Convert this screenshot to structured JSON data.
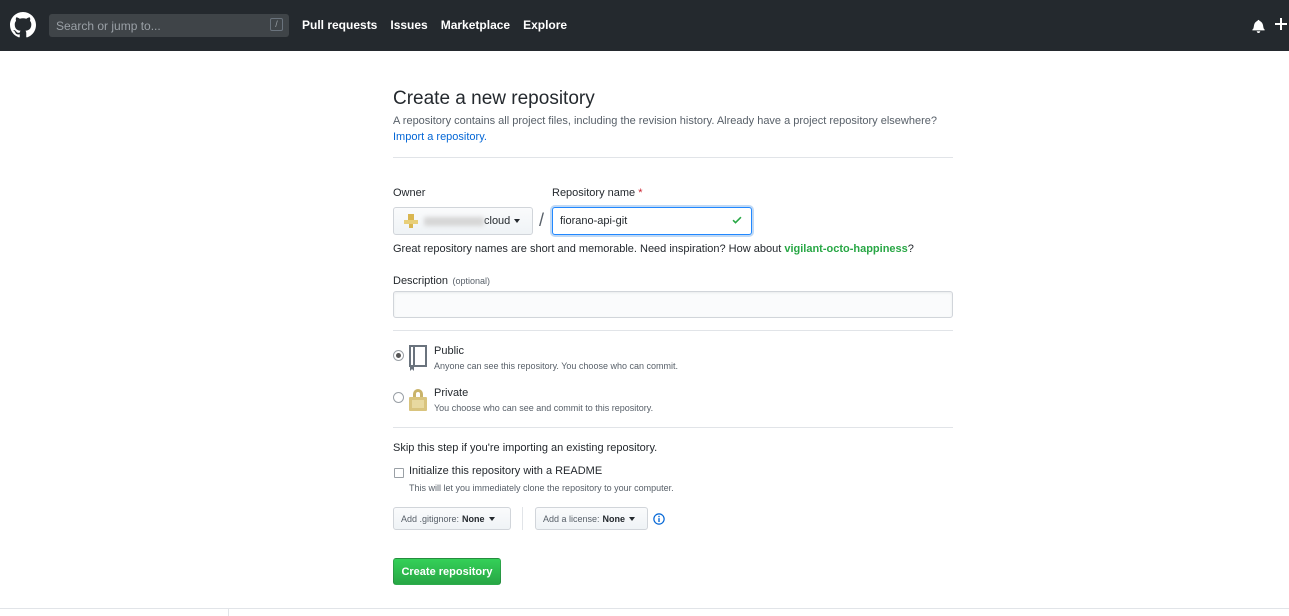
{
  "header": {
    "search_placeholder": "Search or jump to...",
    "search_shortcut": "/",
    "nav": [
      "Pull requests",
      "Issues",
      "Marketplace",
      "Explore"
    ]
  },
  "page": {
    "title": "Create a new repository",
    "description": "A repository contains all project files, including the revision history. Already have a project repository elsewhere?",
    "import_link": "Import a repository."
  },
  "form": {
    "owner_label": "Owner",
    "owner_name_visible": "cloud",
    "repo_label": "Repository name",
    "required_mark": "*",
    "path_separator": "/",
    "repo_value": "fiorano-api-git",
    "hint_prefix": "Great repository names are short and memorable. Need inspiration? How about",
    "hint_suggestion": "vigilant-octo-happiness",
    "hint_suffix": "?",
    "description_label": "Description",
    "description_optional": "(optional)",
    "description_value": "",
    "visibility": [
      {
        "title": "Public",
        "note": "Anyone can see this repository. You choose who can commit.",
        "checked": true
      },
      {
        "title": "Private",
        "note": "You choose who can see and commit to this repository.",
        "checked": false
      }
    ],
    "skip_text": "Skip this step if you're importing an existing repository.",
    "readme_label": "Initialize this repository with a README",
    "readme_note": "This will let you immediately clone the repository to your computer.",
    "gitignore_label": "Add .gitignore:",
    "gitignore_value": "None",
    "license_label": "Add a license:",
    "license_value": "None",
    "submit_label": "Create repository"
  },
  "colors": {
    "header_bg": "#24292e",
    "link": "#0366d6",
    "success": "#28a745",
    "required": "#cb2431"
  }
}
